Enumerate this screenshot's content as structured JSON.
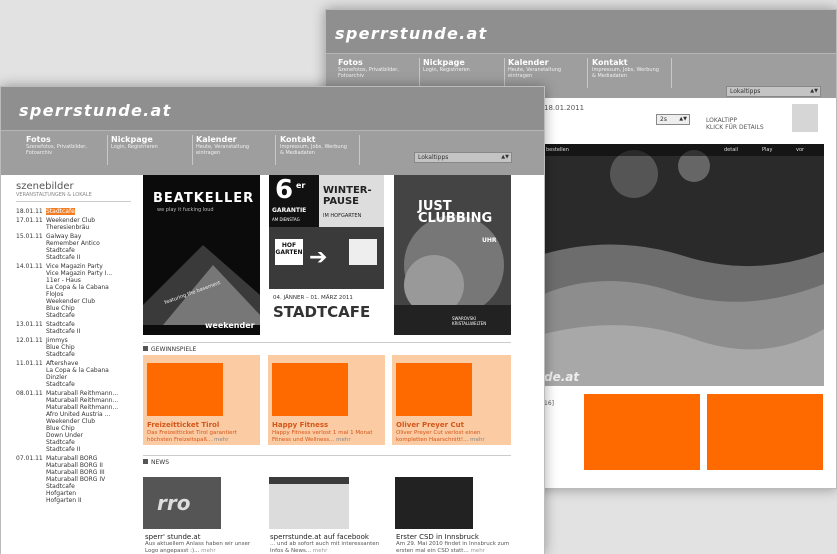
{
  "back": {
    "logo": "sperrstunde.at",
    "nav": [
      {
        "title": "Fotos",
        "sub": "Szenefotos, Privatbilder, Fotoarchiv"
      },
      {
        "title": "Nickpage",
        "sub": "Login, Registrieren"
      },
      {
        "title": "Kalender",
        "sub": "Heute, Veranstaltung eintragen"
      },
      {
        "title": "Kontakt",
        "sub": "Impressum, Jobs, Werbung & Mediadaten"
      }
    ],
    "select_label": "Lokaltipps",
    "date": "18.01.2011",
    "size_select": "2s",
    "lokaltipp_title": "LOKALTIPP",
    "lokaltipp_sub": "KLICK FÜR DETAILS",
    "photo_watermark": "de.at",
    "photo_bar": [
      "bestellen",
      "detail",
      "Play",
      "vor"
    ],
    "side_num": "16]"
  },
  "front": {
    "logo": "sperrstunde.at",
    "nav": [
      {
        "title": "Fotos",
        "sub": "Szenefotos, Privatbilder, Fotoarchiv"
      },
      {
        "title": "Nickpage",
        "sub": "Login, Registrieren"
      },
      {
        "title": "Kalender",
        "sub": "Heute, Veranstaltung eintragen"
      },
      {
        "title": "Kontakt",
        "sub": "Impressum, Jobs, Werbung & Mediadaten"
      }
    ],
    "select_label": "Lokaltipps",
    "sidebar": {
      "title": "szenebilder",
      "subtitle": "VERANSTALTUNGEN & LOKALE",
      "groups": [
        {
          "date": "18.01.11",
          "entries": [
            "Stadtcafe"
          ],
          "highlight": 0
        },
        {
          "date": "17.01.11",
          "entries": [
            "Weekender Club",
            "Theresienbräu"
          ]
        },
        {
          "date": "15.01.11",
          "entries": [
            "Galway Bay",
            "Remember Antico",
            "Stadtcafe",
            "Stadtcafe II"
          ]
        },
        {
          "date": "14.01.11",
          "entries": [
            "Vice Magazin Party",
            "Vice Magazin Party I...",
            "11er - Haus",
            "La Copa & la Cabana",
            "FloJos",
            "Weekender Club",
            "Blue Chip",
            "Stadtcafe"
          ]
        },
        {
          "date": "13.01.11",
          "entries": [
            "Stadtcafe",
            "Stadtcafe II"
          ]
        },
        {
          "date": "12.01.11",
          "entries": [
            "Jimmys",
            "Blue Chip",
            "Stadtcafe"
          ]
        },
        {
          "date": "11.01.11",
          "entries": [
            "Aftershave",
            "La Copa & la Cabana",
            "Dinzler",
            "Stadtcafe"
          ]
        },
        {
          "date": "08.01.11",
          "entries": [
            "Maturaball Reithmann...",
            "Maturaball Reithmann...",
            "Maturaball Reithmann...",
            "Afro United Austria ...",
            "Weekender Club",
            "Blue Chip",
            "Down Under",
            "Stadtcafe",
            "Stadtcafe II"
          ]
        },
        {
          "date": "07.01.11",
          "entries": [
            "Maturaball BORG",
            "Maturaball BORG II",
            "Maturaball BORG III",
            "Maturaball BORG IV",
            "Stadtcafe",
            "Hofgarten",
            "Hofgarten II"
          ]
        }
      ]
    },
    "posters": [
      {
        "main": "BEATKELLER",
        "sub": "we play it fucking loud",
        "foot": "weekender",
        "tag": "featuring the basement"
      },
      {
        "left_big": "6",
        "left_sup": "er",
        "left_sub": "GARANTIE",
        "left_small": "AM DIENSTAG",
        "right_big": "WINTER-PAUSE",
        "right_small": "IM HOFGARTEN",
        "hof": "HOF GARTEN",
        "dates": "04. JÄNNER – 01. MÄRZ 2011",
        "venue": "STADTCAFE"
      },
      {
        "main": "JUST CLUBBING",
        "foot": "SWAROVSKI KRISTALLWELTEN",
        "uhr": "UHR"
      }
    ],
    "gewinnspiele_title": "GEWINNSPIELE",
    "gewinnspiele": [
      {
        "title": "Freizeitticket Tirol",
        "desc": "Das Freizeitticket Tirol garantiert höchsten Freizeitspaß...",
        "more": "mehr"
      },
      {
        "title": "Happy Fitness",
        "desc": "Happy Fitness verlost 1 mal 1 Monat Fitness und Wellness...",
        "more": "mehr"
      },
      {
        "title": "Oliver Preyer Cut",
        "desc": "Oliver Preyer Cut verlost einen kompletten Haarschnitt!...",
        "more": "mehr"
      }
    ],
    "news_title": "NEWS",
    "news": [
      {
        "title": "sperr' stunde.at",
        "desc": "Aus aktuellem Anlass haben wir unser Logo angepasst :)...",
        "more": "mehr",
        "img_text": "rro"
      },
      {
        "title": "sperrstunde.at auf facebook",
        "desc": "... und ab sofort auch mit interessanten Infos & News...",
        "more": "mehr"
      },
      {
        "title": "Erster CSD in Innsbruck",
        "desc": "Am 29. Mai 2010 findet in Innsbruck zum ersten mal ein CSD statt...",
        "more": "mehr"
      }
    ]
  }
}
